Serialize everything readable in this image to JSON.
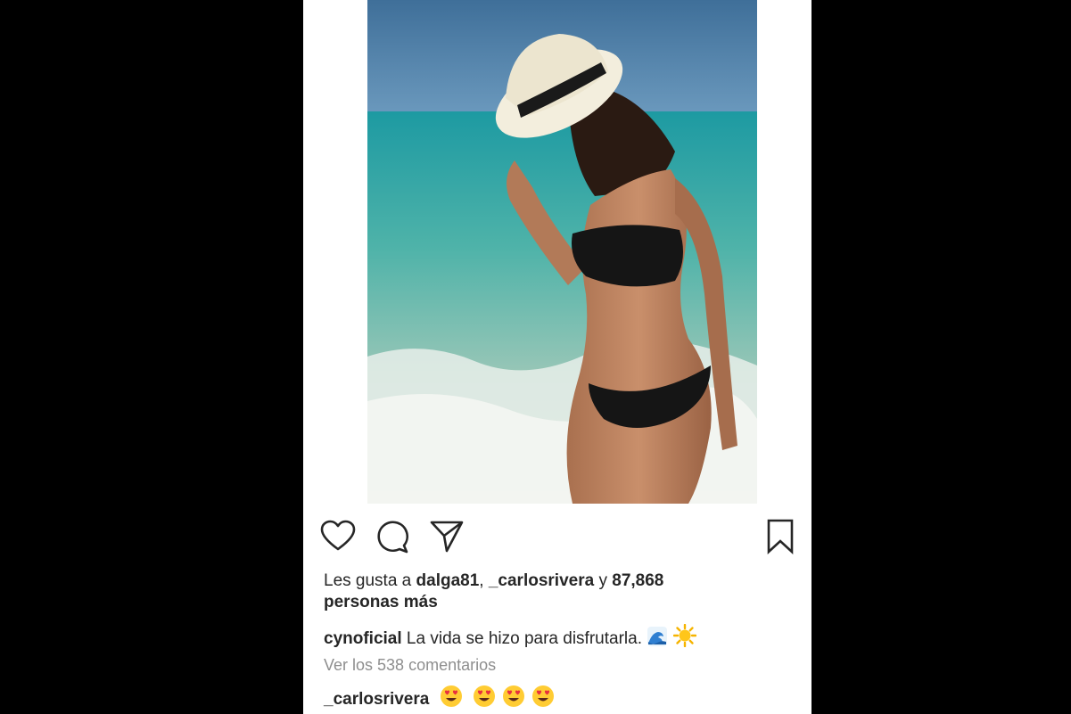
{
  "post": {
    "photo_icon": "beach-photo",
    "actions": {
      "like_icon": "heart-icon",
      "comment_icon": "comment-bubble-icon",
      "share_icon": "paper-plane-icon",
      "save_icon": "bookmark-icon"
    },
    "likes": {
      "prefix": "Les gusta a ",
      "user1": "dalga81",
      "separator": ", ",
      "user2": "_carlosrivera",
      "connector": " y ",
      "count": "87,868",
      "suffix": "personas más"
    },
    "caption": {
      "username": "cynoficial",
      "text": " La vida se hizo para disfrutarla. ",
      "emojis": [
        "wave-emoji",
        "sun-emoji"
      ]
    },
    "view_comments": "Ver los 538 comentarios",
    "comment": {
      "username": "_carlosrivera",
      "emojis": [
        "heart-eyes-emoji",
        "heart-eyes-emoji",
        "heart-eyes-emoji",
        "heart-eyes-emoji"
      ]
    }
  },
  "colors": {
    "background": "#000000",
    "card": "#ffffff",
    "text": "#262626",
    "muted": "#8e8e8e"
  }
}
